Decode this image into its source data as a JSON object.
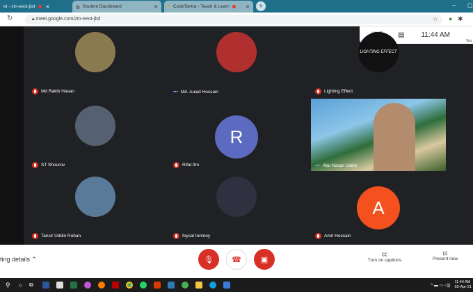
{
  "browser": {
    "tabs": [
      {
        "title": "et - ztn-eeot-jbd",
        "recording": true
      },
      {
        "title": "Student Dashboard"
      },
      {
        "title": "CodeTantra - Teach & Learn",
        "recording": true
      }
    ],
    "url": "meet.google.com/ztn-eeot-jbd"
  },
  "meet": {
    "participants_count": "10",
    "time": "11:44 AM",
    "you_label": "You",
    "participants": [
      {
        "name": "Md Rakib Hasan",
        "muted": true,
        "color": "#8a7a50"
      },
      {
        "name": "Md. Aulad Hossain",
        "muted": false,
        "speaking": true,
        "color": "#b03030"
      },
      {
        "name": "Lighting Effect",
        "muted": true,
        "avatar_text": "LIGHTING EFFECT",
        "color": "#111111"
      },
      {
        "name": "ST Shourov",
        "muted": true,
        "color": "#556070"
      },
      {
        "name": "Rifat ttm",
        "muted": true,
        "initial": "R",
        "color": "#5c6bc0"
      },
      {
        "name": "Abu Nasar Uddin",
        "muted": false,
        "speaking": true,
        "video": true
      },
      {
        "name": "Tansir Uddin Ruhan",
        "muted": true,
        "color": "#5a7a9a"
      },
      {
        "name": "foysal tonmoy",
        "muted": true,
        "color": "#303040"
      },
      {
        "name": "Amir Hossain",
        "muted": true,
        "initial": "A",
        "color": "#f4511e"
      }
    ],
    "bottom": {
      "meeting_details": "ting details",
      "captions": "Turn on captions",
      "present": "Present now"
    }
  },
  "taskbar": {
    "time": "11:44 AM",
    "date": "02-Apr-21"
  }
}
